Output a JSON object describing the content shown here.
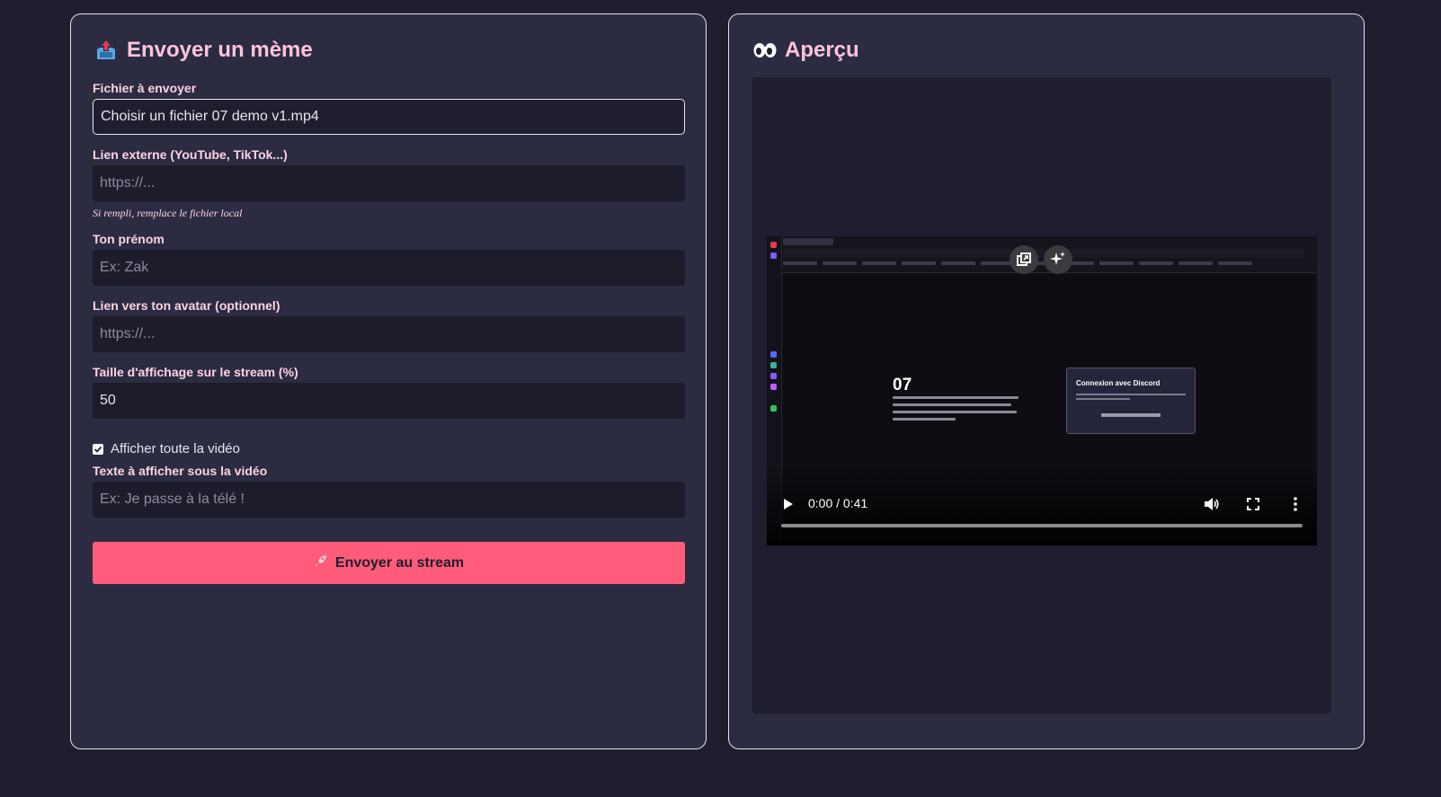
{
  "form": {
    "title": "Envoyer un mème",
    "file": {
      "label": "Fichier à envoyer",
      "value": "Choisir un fichier 07 demo v1.mp4"
    },
    "external_link": {
      "label": "Lien externe (YouTube, TikTok...)",
      "placeholder": "https://...",
      "hint": "Si rempli, remplace le fichier local"
    },
    "first_name": {
      "label": "Ton prénom",
      "placeholder": "Ex: Zak"
    },
    "avatar": {
      "label": "Lien vers ton avatar (optionnel)",
      "placeholder": "https://..."
    },
    "size": {
      "label": "Taille d'affichage sur le stream (%)",
      "value": "50"
    },
    "show_full": {
      "label": "Afficher toute la vidéo",
      "checked": true
    },
    "caption": {
      "label": "Texte à afficher sous la vidéo",
      "placeholder": "Ex: Je passe à la télé !"
    },
    "submit_label": "Envoyer au stream"
  },
  "preview": {
    "title": "Aperçu",
    "video": {
      "time": "0:00 / 0:41",
      "progress": 0,
      "frame_heading": "07",
      "frame_card_title": "Connexion avec Discord"
    }
  },
  "colors": {
    "accent": "#ff5c7b",
    "title": "#ffc4db",
    "panel": "#2b2b42",
    "background": "#1e1e2e"
  }
}
